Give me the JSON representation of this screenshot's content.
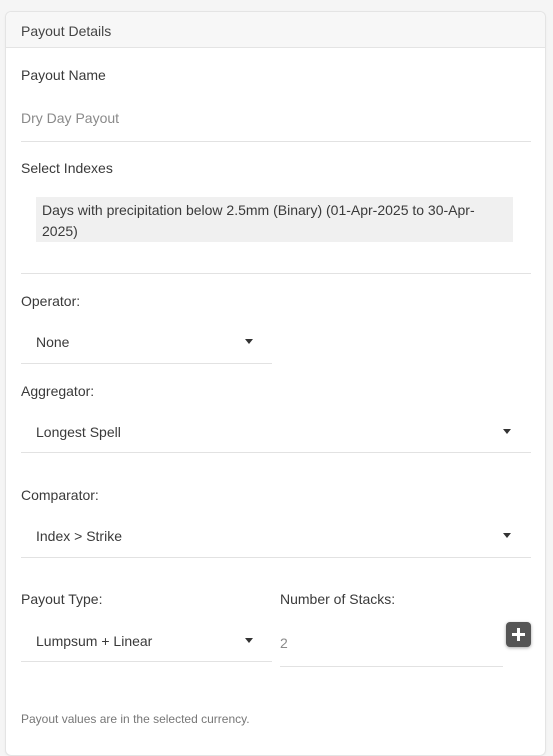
{
  "header": {
    "title": "Payout Details"
  },
  "payout_name": {
    "label": "Payout Name",
    "placeholder": "Dry Day Payout"
  },
  "indexes": {
    "label": "Select Indexes",
    "selected": "Days with precipitation below 2.5mm (Binary) (01-Apr-2025 to 30-Apr-2025)"
  },
  "operator": {
    "label": "Operator:",
    "value": "None"
  },
  "aggregator": {
    "label": "Aggregator:",
    "value": "Longest Spell"
  },
  "comparator": {
    "label": "Comparator:",
    "value": "Index > Strike"
  },
  "payout_type": {
    "label": "Payout Type:",
    "value": "Lumpsum + Linear"
  },
  "stacks": {
    "label": "Number of Stacks:",
    "value": "2"
  },
  "footer_note": "Payout values are in the selected currency.",
  "icons": {
    "dropdown": "caret-down-icon",
    "add": "plus-icon"
  }
}
